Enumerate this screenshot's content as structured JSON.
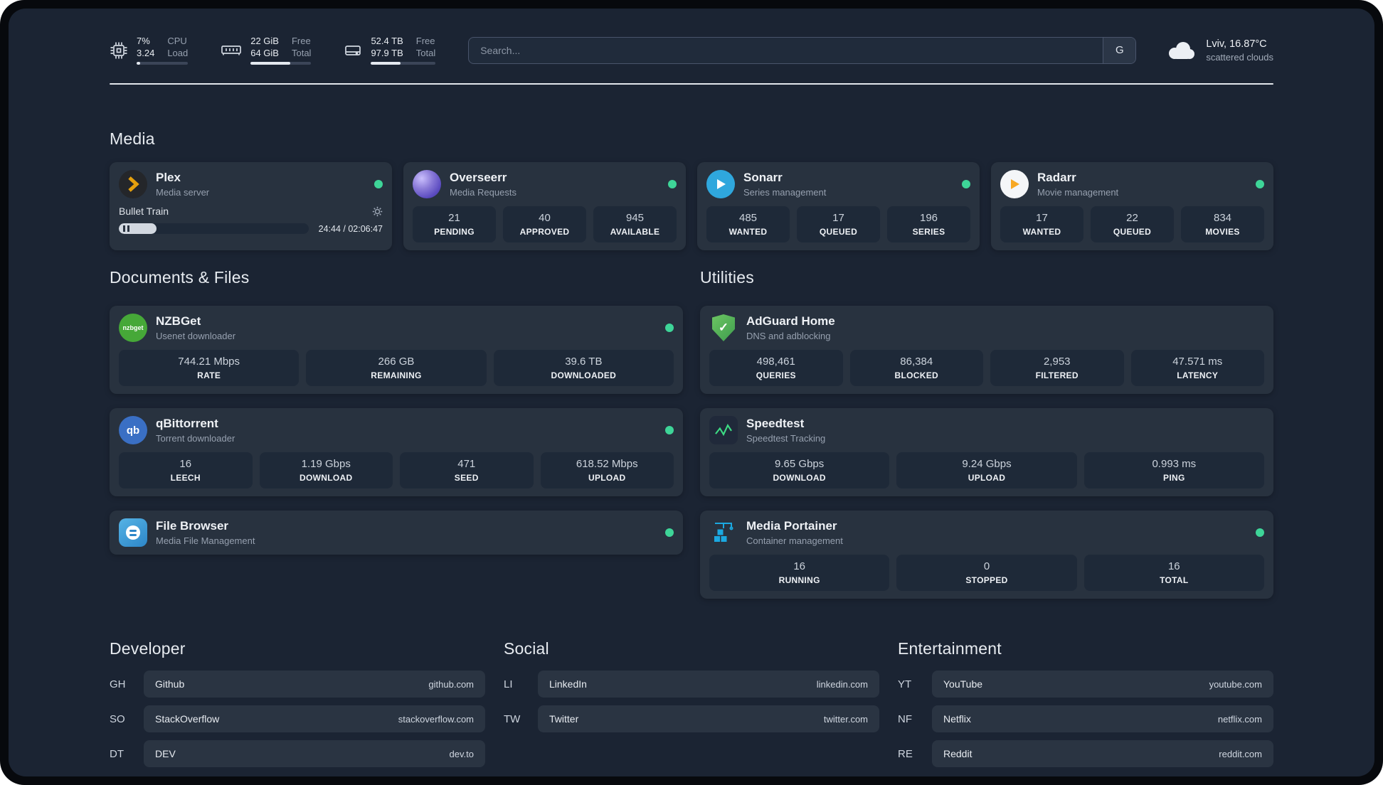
{
  "topbar": {
    "cpu": {
      "value1": "7%",
      "value2": "3.24",
      "label1": "CPU",
      "label2": "Load",
      "meter_width": "7%"
    },
    "ram": {
      "value1": "22 GiB",
      "value2": "64 GiB",
      "label1": "Free",
      "label2": "Total",
      "meter_width": "66%"
    },
    "disk": {
      "value1": "52.4 TB",
      "value2": "97.9 TB",
      "label1": "Free",
      "label2": "Total",
      "meter_width": "46%"
    },
    "search": {
      "placeholder": "Search...",
      "button_label": "G"
    },
    "weather": {
      "location": "Lviv, 16.87°C",
      "condition": "scattered clouds"
    }
  },
  "media": {
    "title": "Media",
    "cards": [
      {
        "name": "Plex",
        "sub": "Media server",
        "status": "online",
        "player": {
          "track": "Bullet Train",
          "time": "24:44 / 02:06:47",
          "progress_width": "20%"
        }
      },
      {
        "name": "Overseerr",
        "sub": "Media Requests",
        "status": "online",
        "stats": [
          {
            "value": "21",
            "label": "PENDING"
          },
          {
            "value": "40",
            "label": "APPROVED"
          },
          {
            "value": "945",
            "label": "AVAILABLE"
          }
        ]
      },
      {
        "name": "Sonarr",
        "sub": "Series management",
        "status": "online",
        "stats": [
          {
            "value": "485",
            "label": "WANTED"
          },
          {
            "value": "17",
            "label": "QUEUED"
          },
          {
            "value": "196",
            "label": "SERIES"
          }
        ]
      },
      {
        "name": "Radarr",
        "sub": "Movie management",
        "status": "online",
        "stats": [
          {
            "value": "17",
            "label": "WANTED"
          },
          {
            "value": "22",
            "label": "QUEUED"
          },
          {
            "value": "834",
            "label": "MOVIES"
          }
        ]
      }
    ]
  },
  "documents": {
    "title": "Documents & Files",
    "cards": [
      {
        "name": "NZBGet",
        "sub": "Usenet downloader",
        "status": "online",
        "stats": [
          {
            "value": "744.21 Mbps",
            "label": "RATE"
          },
          {
            "value": "266 GB",
            "label": "REMAINING"
          },
          {
            "value": "39.6 TB",
            "label": "DOWNLOADED"
          }
        ]
      },
      {
        "name": "qBittorrent",
        "sub": "Torrent downloader",
        "status": "online",
        "stats": [
          {
            "value": "16",
            "label": "LEECH"
          },
          {
            "value": "1.19 Gbps",
            "label": "DOWNLOAD"
          },
          {
            "value": "471",
            "label": "SEED"
          },
          {
            "value": "618.52 Mbps",
            "label": "UPLOAD"
          }
        ]
      },
      {
        "name": "File Browser",
        "sub": "Media File Management",
        "status": "online"
      }
    ]
  },
  "utilities": {
    "title": "Utilities",
    "cards": [
      {
        "name": "AdGuard Home",
        "sub": "DNS and adblocking",
        "stats": [
          {
            "value": "498,461",
            "label": "QUERIES"
          },
          {
            "value": "86,384",
            "label": "BLOCKED"
          },
          {
            "value": "2,953",
            "label": "FILTERED"
          },
          {
            "value": "47.571 ms",
            "label": "LATENCY"
          }
        ]
      },
      {
        "name": "Speedtest",
        "sub": "Speedtest Tracking",
        "stats": [
          {
            "value": "9.65 Gbps",
            "label": "DOWNLOAD"
          },
          {
            "value": "9.24 Gbps",
            "label": "UPLOAD"
          },
          {
            "value": "0.993 ms",
            "label": "PING"
          }
        ]
      },
      {
        "name": "Media Portainer",
        "sub": "Container management",
        "status": "online",
        "stats": [
          {
            "value": "16",
            "label": "RUNNING"
          },
          {
            "value": "0",
            "label": "STOPPED"
          },
          {
            "value": "16",
            "label": "TOTAL"
          }
        ]
      }
    ]
  },
  "bookmarks": {
    "developer": {
      "title": "Developer",
      "items": [
        {
          "abbr": "GH",
          "name": "Github",
          "url": "github.com"
        },
        {
          "abbr": "SO",
          "name": "StackOverflow",
          "url": "stackoverflow.com"
        },
        {
          "abbr": "DT",
          "name": "DEV",
          "url": "dev.to"
        }
      ]
    },
    "social": {
      "title": "Social",
      "items": [
        {
          "abbr": "LI",
          "name": "LinkedIn",
          "url": "linkedin.com"
        },
        {
          "abbr": "TW",
          "name": "Twitter",
          "url": "twitter.com"
        }
      ]
    },
    "entertainment": {
      "title": "Entertainment",
      "items": [
        {
          "abbr": "YT",
          "name": "YouTube",
          "url": "youtube.com"
        },
        {
          "abbr": "NF",
          "name": "Netflix",
          "url": "netflix.com"
        },
        {
          "abbr": "RE",
          "name": "Reddit",
          "url": "reddit.com"
        }
      ]
    }
  },
  "icons": {
    "check": "✓",
    "nzbget_text": "nzbget",
    "qbittorrent_text": "qb"
  },
  "colors": {
    "status_online": "#3ed598",
    "background": "#1b2433",
    "card": "#28323f",
    "tile": "#1e2938"
  }
}
